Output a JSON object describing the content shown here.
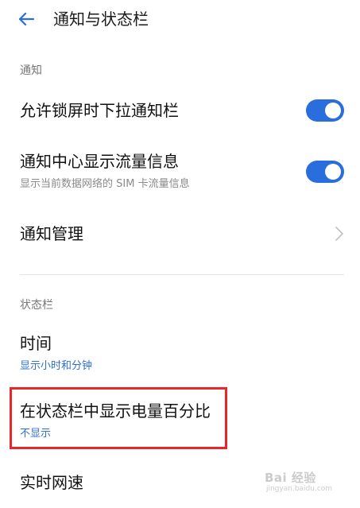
{
  "header": {
    "title": "通知与状态栏"
  },
  "sections": {
    "notifications": {
      "label": "通知",
      "lockscreen_pulldown": {
        "title": "允许锁屏时下拉通知栏",
        "enabled": true
      },
      "show_traffic": {
        "title": "通知中心显示流量信息",
        "subtitle": "显示当前数据网络的 SIM 卡流量信息",
        "enabled": true
      },
      "manage": {
        "title": "通知管理"
      }
    },
    "status_bar": {
      "label": "状态栏",
      "time": {
        "title": "时间",
        "value": "显示小时和分钟"
      },
      "battery_percent": {
        "title": "在状态栏中显示电量百分比",
        "value": "不显示"
      },
      "network_speed": {
        "title": "实时网速"
      }
    }
  },
  "watermark": {
    "brand": "Bai 经验",
    "url": "jingyan.baidu.com"
  },
  "colors": {
    "accent": "#2a6ede",
    "link": "#2d6fd6",
    "highlight": "#e8262c"
  }
}
